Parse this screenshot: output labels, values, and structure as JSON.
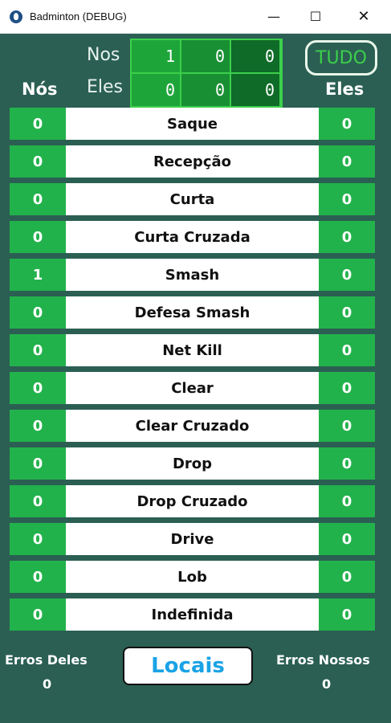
{
  "window": {
    "title": "Badminton (DEBUG)",
    "minimize": "—",
    "maximize": "☐",
    "close": "✕"
  },
  "header": {
    "nos_row_label": "Nos",
    "eles_row_label": "Eles",
    "left_column": "Nós",
    "right_column": "Eles",
    "tudo_button": "TUDO",
    "score": {
      "nos": [
        "1",
        "0",
        "0"
      ],
      "eles": [
        "0",
        "0",
        "0"
      ]
    }
  },
  "stats": [
    {
      "action": "Saque",
      "nos": "0",
      "eles": "0"
    },
    {
      "action": "Recepção",
      "nos": "0",
      "eles": "0"
    },
    {
      "action": "Curta",
      "nos": "0",
      "eles": "0"
    },
    {
      "action": "Curta Cruzada",
      "nos": "0",
      "eles": "0"
    },
    {
      "action": "Smash",
      "nos": "1",
      "eles": "0"
    },
    {
      "action": "Defesa Smash",
      "nos": "0",
      "eles": "0"
    },
    {
      "action": "Net Kill",
      "nos": "0",
      "eles": "0"
    },
    {
      "action": "Clear",
      "nos": "0",
      "eles": "0"
    },
    {
      "action": "Clear Cruzado",
      "nos": "0",
      "eles": "0"
    },
    {
      "action": "Drop",
      "nos": "0",
      "eles": "0"
    },
    {
      "action": "Drop Cruzado",
      "nos": "0",
      "eles": "0"
    },
    {
      "action": "Drive",
      "nos": "0",
      "eles": "0"
    },
    {
      "action": "Lob",
      "nos": "0",
      "eles": "0"
    },
    {
      "action": "Indefinida",
      "nos": "0",
      "eles": "0"
    }
  ],
  "footer": {
    "erros_deles_label": "Erros Deles",
    "erros_deles_value": "0",
    "locais_button": "Locais",
    "erros_nossos_label": "Erros Nossos",
    "erros_nossos_value": "0"
  },
  "colors": {
    "background": "#2b5f53",
    "count_green": "#22b24b",
    "score_border": "#3ccf4b",
    "locais_text": "#1aa3e6"
  }
}
